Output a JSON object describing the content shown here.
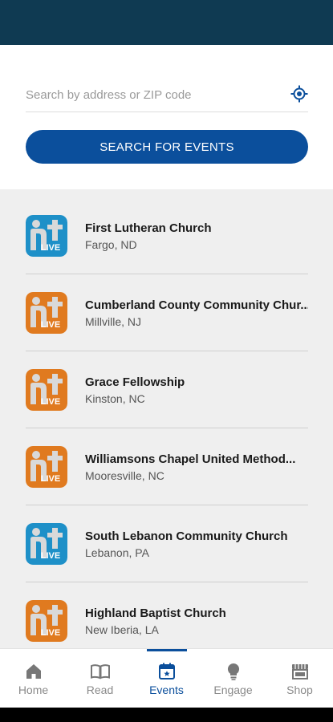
{
  "search": {
    "placeholder": "Search by address or ZIP code",
    "button_label": "SEARCH FOR EVENTS"
  },
  "events": [
    {
      "name": "First Lutheran Church",
      "location": "Fargo, ND",
      "logo_color": "#1e90c8"
    },
    {
      "name": "Cumberland County Community Chur...",
      "location": "Millville, NJ",
      "logo_color": "#e07a1f"
    },
    {
      "name": "Grace Fellowship",
      "location": "Kinston, NC",
      "logo_color": "#e07a1f"
    },
    {
      "name": "Williamsons Chapel United Method...",
      "location": "Mooresville, NC",
      "logo_color": "#e07a1f"
    },
    {
      "name": "South Lebanon Community Church",
      "location": "Lebanon, PA",
      "logo_color": "#1e90c8"
    },
    {
      "name": "Highland Baptist Church",
      "location": "New Iberia, LA",
      "logo_color": "#e07a1f"
    }
  ],
  "logo_badge": "LIVE",
  "nav": {
    "items": [
      {
        "label": "Home",
        "icon": "home-icon"
      },
      {
        "label": "Read",
        "icon": "book-icon"
      },
      {
        "label": "Events",
        "icon": "calendar-icon",
        "active": true
      },
      {
        "label": "Engage",
        "icon": "lightbulb-icon"
      },
      {
        "label": "Shop",
        "icon": "store-icon"
      }
    ]
  },
  "colors": {
    "header": "#0f3a52",
    "accent": "#0b4f9c",
    "list_background": "#efefef"
  }
}
